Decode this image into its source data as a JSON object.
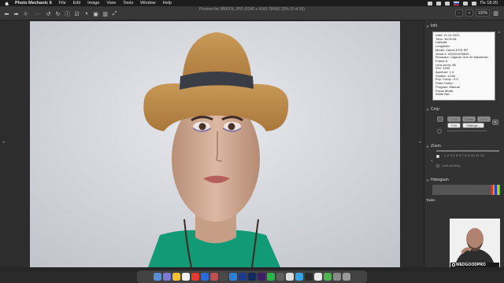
{
  "menubar": {
    "app_name": "Photo Mechanic 6",
    "items": [
      "File",
      "Edit",
      "Image",
      "View",
      "Tools",
      "Window",
      "Help"
    ],
    "clock": "Пн 18:20"
  },
  "toolbar": {
    "window_title": "Preview for 9B00OL.JPG (6240 x 4160 785W) 23% (9 of 20)",
    "zoom_value": "100%",
    "minus_label": "−",
    "plus_label": "+"
  },
  "info_panel": {
    "title": "Info",
    "lines": [
      "Date: 21.01.2021",
      "Time: 16:20:06",
      "Latitude:",
      "Longitude:",
      "Model: Canon EOS RP",
      "Serial #: 023021005649",
      "Firmware: Capture One 20 Macintosh",
      "Frame #:",
      "Lens (mm): 85",
      "ISO: 1250",
      "Aperture: 1.4",
      "Shutter: 1/160",
      "Exp. Comp.: 0.0",
      "Flash Comp.:",
      "Program: Manual",
      "Focus Mode:",
      "White Bal.:"
    ]
  },
  "crop_panel": {
    "title": "Crop",
    "buttons": [
      "Crop",
      "Rotate",
      "Clear",
      "Full",
      "Settings..."
    ]
  },
  "zoom_panel": {
    "title": "Zoom",
    "lock_label": "Lock scrolling"
  },
  "histogram_panel": {
    "title": "Histogram"
  },
  "tasks_panel": {
    "title": "Tasks"
  },
  "overlay": {
    "brand": "WEDGOODPRO"
  },
  "colors": {
    "stage_bg": "#c9cbd0",
    "panel_bg": "#323232",
    "toolbar_bg": "#383838"
  }
}
